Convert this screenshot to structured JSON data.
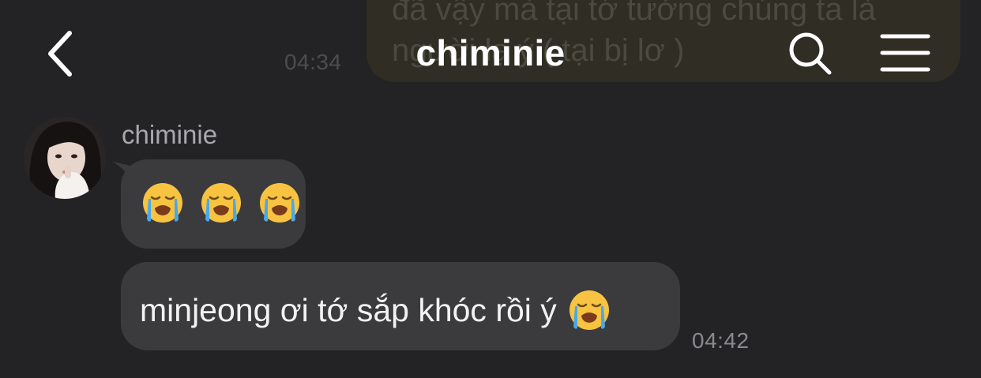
{
  "previous_message": {
    "text": "đã vậy mà tại tớ tưởng chúng ta là\nngười lạ ý ( tại bị lơ )",
    "time": "04:34"
  },
  "header": {
    "title": "chiminie",
    "back_icon": "chevron-left-icon",
    "search_icon": "search-icon",
    "menu_icon": "hamburger-menu-icon"
  },
  "conversation": {
    "sender_name": "chiminie",
    "messages": [
      {
        "type": "emoji",
        "emojis": [
          "loudly-crying-face",
          "loudly-crying-face",
          "loudly-crying-face"
        ]
      },
      {
        "type": "text",
        "text": "minjeong ơi tớ sắp khóc rồi ý",
        "trailing_emoji": "loudly-crying-face",
        "time": "04:42"
      }
    ]
  },
  "colors": {
    "background": "#232325",
    "bubble": "#3b3b3e",
    "previous_bubble": "#3a3624",
    "text": "#ffffff",
    "muted": "#8a8a8e"
  }
}
